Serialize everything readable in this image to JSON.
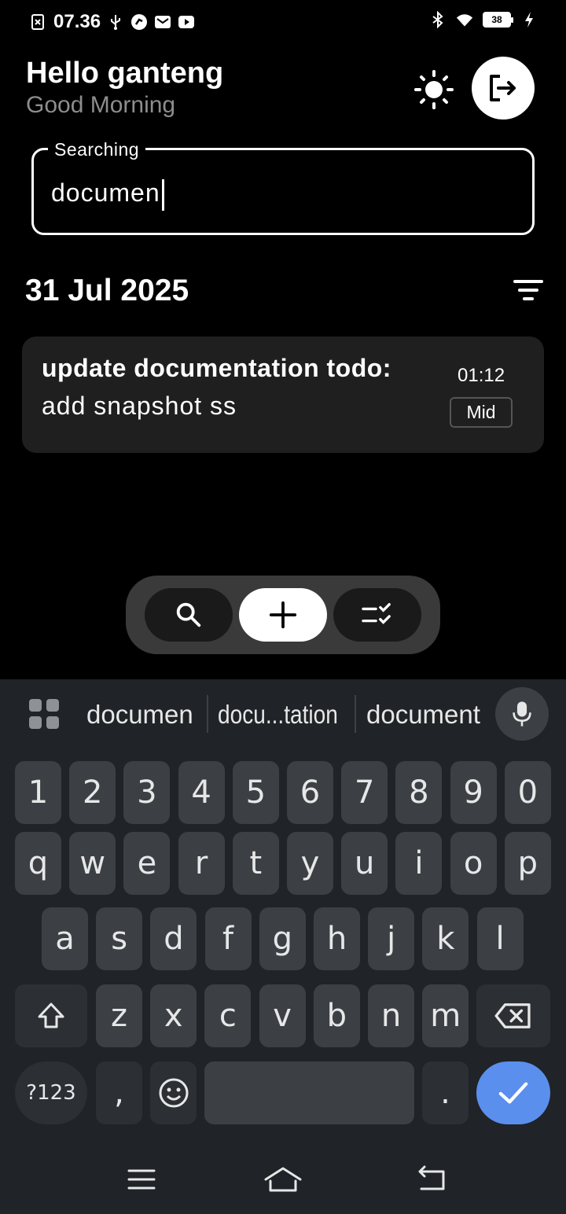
{
  "status_bar": {
    "time": "07.36",
    "battery": "38"
  },
  "header": {
    "greeting": "Hello ganteng",
    "subtitle": "Good Morning"
  },
  "search": {
    "label": "Searching",
    "value": "documen"
  },
  "date_group": {
    "date": "31 Jul 2025"
  },
  "todos": [
    {
      "title": "update documentation todo:",
      "description": "add snapshot ss",
      "time": "01:12",
      "priority": "Mid"
    }
  ],
  "keyboard": {
    "suggestions": [
      "documen",
      "docu...tation",
      "document"
    ],
    "row_numbers": [
      "1",
      "2",
      "3",
      "4",
      "5",
      "6",
      "7",
      "8",
      "9",
      "0"
    ],
    "row_1": [
      "q",
      "w",
      "e",
      "r",
      "t",
      "y",
      "u",
      "i",
      "o",
      "p"
    ],
    "row_2": [
      "a",
      "s",
      "d",
      "f",
      "g",
      "h",
      "j",
      "k",
      "l"
    ],
    "row_3": [
      "z",
      "x",
      "c",
      "v",
      "b",
      "n",
      "m"
    ],
    "symbols_key": "?123",
    "comma_key": ",",
    "period_key": ".",
    "accent_color": "#5b8fed"
  },
  "colors": {
    "background": "#000000",
    "card": "#1f1f1f",
    "muted_text": "#8d8d8d",
    "keyboard_bg": "#202327"
  }
}
